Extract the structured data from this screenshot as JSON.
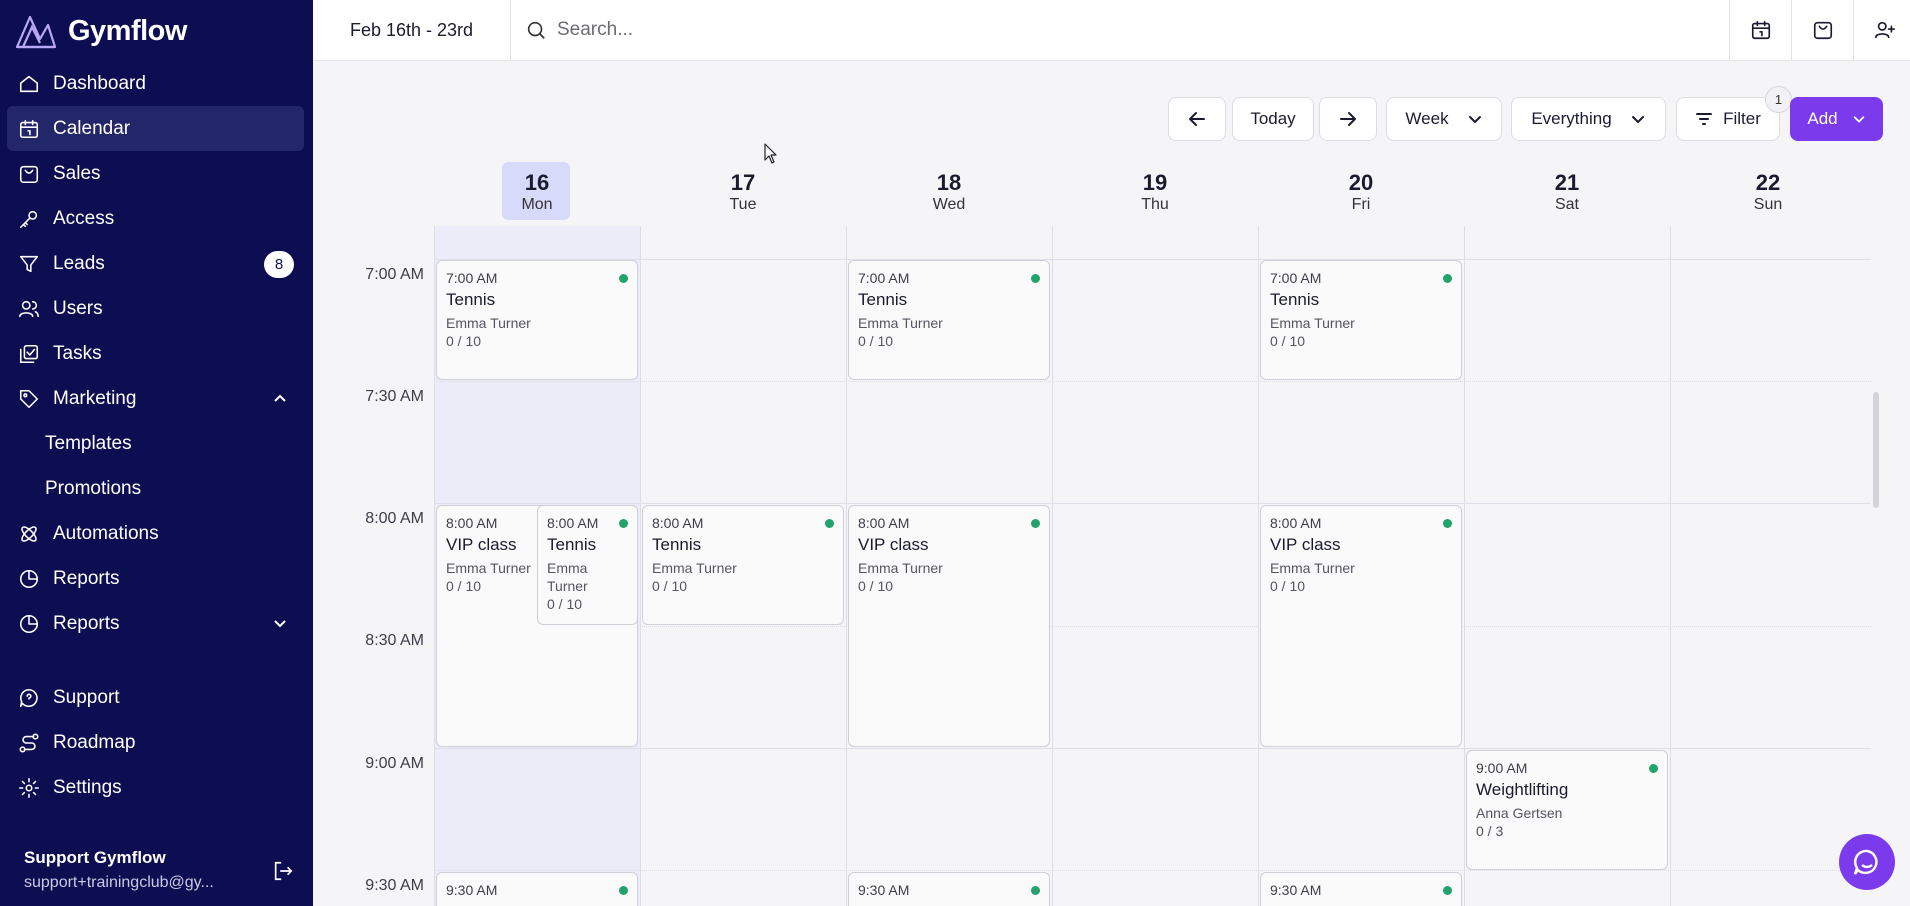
{
  "app": {
    "name": "Gymflow"
  },
  "sidebar": {
    "items": [
      {
        "label": "Dashboard",
        "icon": "home-icon"
      },
      {
        "label": "Calendar",
        "icon": "calendar-icon",
        "active": true
      },
      {
        "label": "Sales",
        "icon": "shopping-bag-icon"
      },
      {
        "label": "Access",
        "icon": "key-icon"
      },
      {
        "label": "Leads",
        "icon": "funnel-icon",
        "badge": "8"
      },
      {
        "label": "Users",
        "icon": "users-icon"
      },
      {
        "label": "Tasks",
        "icon": "tasks-icon"
      },
      {
        "label": "Marketing",
        "icon": "tag-icon",
        "expanded": true
      },
      {
        "label": "Templates"
      },
      {
        "label": "Promotions"
      },
      {
        "label": "Automations",
        "icon": "atom-icon"
      },
      {
        "label": "Reports",
        "icon": "pie-chart-icon"
      },
      {
        "label": "Reports",
        "icon": "pie-chart-icon",
        "expanded": false
      },
      {
        "label": "Support",
        "icon": "help-chat-icon"
      },
      {
        "label": "Roadmap",
        "icon": "route-icon"
      },
      {
        "label": "Settings",
        "icon": "gear-icon"
      }
    ],
    "user": {
      "name": "Support Gymflow",
      "email": "support+trainingclub@gy..."
    }
  },
  "topbar": {
    "date_range": "Feb 16th - 23rd",
    "search_placeholder": "Search...",
    "icons": [
      "calendar-icon",
      "shopping-bag-icon",
      "add-user-icon"
    ]
  },
  "toolbar": {
    "today": "Today",
    "view": "Week",
    "scope": "Everything",
    "filter": "Filter",
    "filter_count": "1",
    "add": "Add"
  },
  "calendar": {
    "days": [
      {
        "num": "16",
        "name": "Mon",
        "today": true
      },
      {
        "num": "17",
        "name": "Tue"
      },
      {
        "num": "18",
        "name": "Wed"
      },
      {
        "num": "19",
        "name": "Thu"
      },
      {
        "num": "20",
        "name": "Fri"
      },
      {
        "num": "21",
        "name": "Sat"
      },
      {
        "num": "22",
        "name": "Sun"
      }
    ],
    "times": [
      "7:00 AM",
      "7:30 AM",
      "8:00 AM",
      "8:30 AM",
      "9:00 AM",
      "9:30 AM"
    ],
    "events": [
      {
        "time": "7:00 AM",
        "name": "Tennis",
        "coach": "Emma Turner",
        "capacity": "0 / 10"
      },
      {
        "time": "7:00 AM",
        "name": "Tennis",
        "coach": "Emma Turner",
        "capacity": "0 / 10"
      },
      {
        "time": "7:00 AM",
        "name": "Tennis",
        "coach": "Emma Turner",
        "capacity": "0 / 10"
      },
      {
        "time": "8:00 AM",
        "name": "VIP class",
        "coach": "Emma Turner",
        "capacity": "0 / 10"
      },
      {
        "time": "8:00 AM",
        "name": "Tennis",
        "coach": "Emma Turner",
        "capacity": "0 / 10"
      },
      {
        "time": "8:00 AM",
        "name": "Tennis",
        "coach": "Emma Turner",
        "capacity": "0 / 10"
      },
      {
        "time": "8:00 AM",
        "name": "VIP class",
        "coach": "Emma Turner",
        "capacity": "0 / 10"
      },
      {
        "time": "8:00 AM",
        "name": "VIP class",
        "coach": "Emma Turner",
        "capacity": "0 / 10"
      },
      {
        "time": "9:00 AM",
        "name": "Weightlifting",
        "coach": "Anna Gertsen",
        "capacity": "0 / 3"
      },
      {
        "time": "9:30 AM"
      },
      {
        "time": "9:30 AM"
      },
      {
        "time": "9:30 AM"
      }
    ]
  },
  "colors": {
    "sidebar": "#0d0e52",
    "accent": "#7c3aed",
    "status_dot": "#22a36b",
    "today_pill": "#d8dafa"
  }
}
